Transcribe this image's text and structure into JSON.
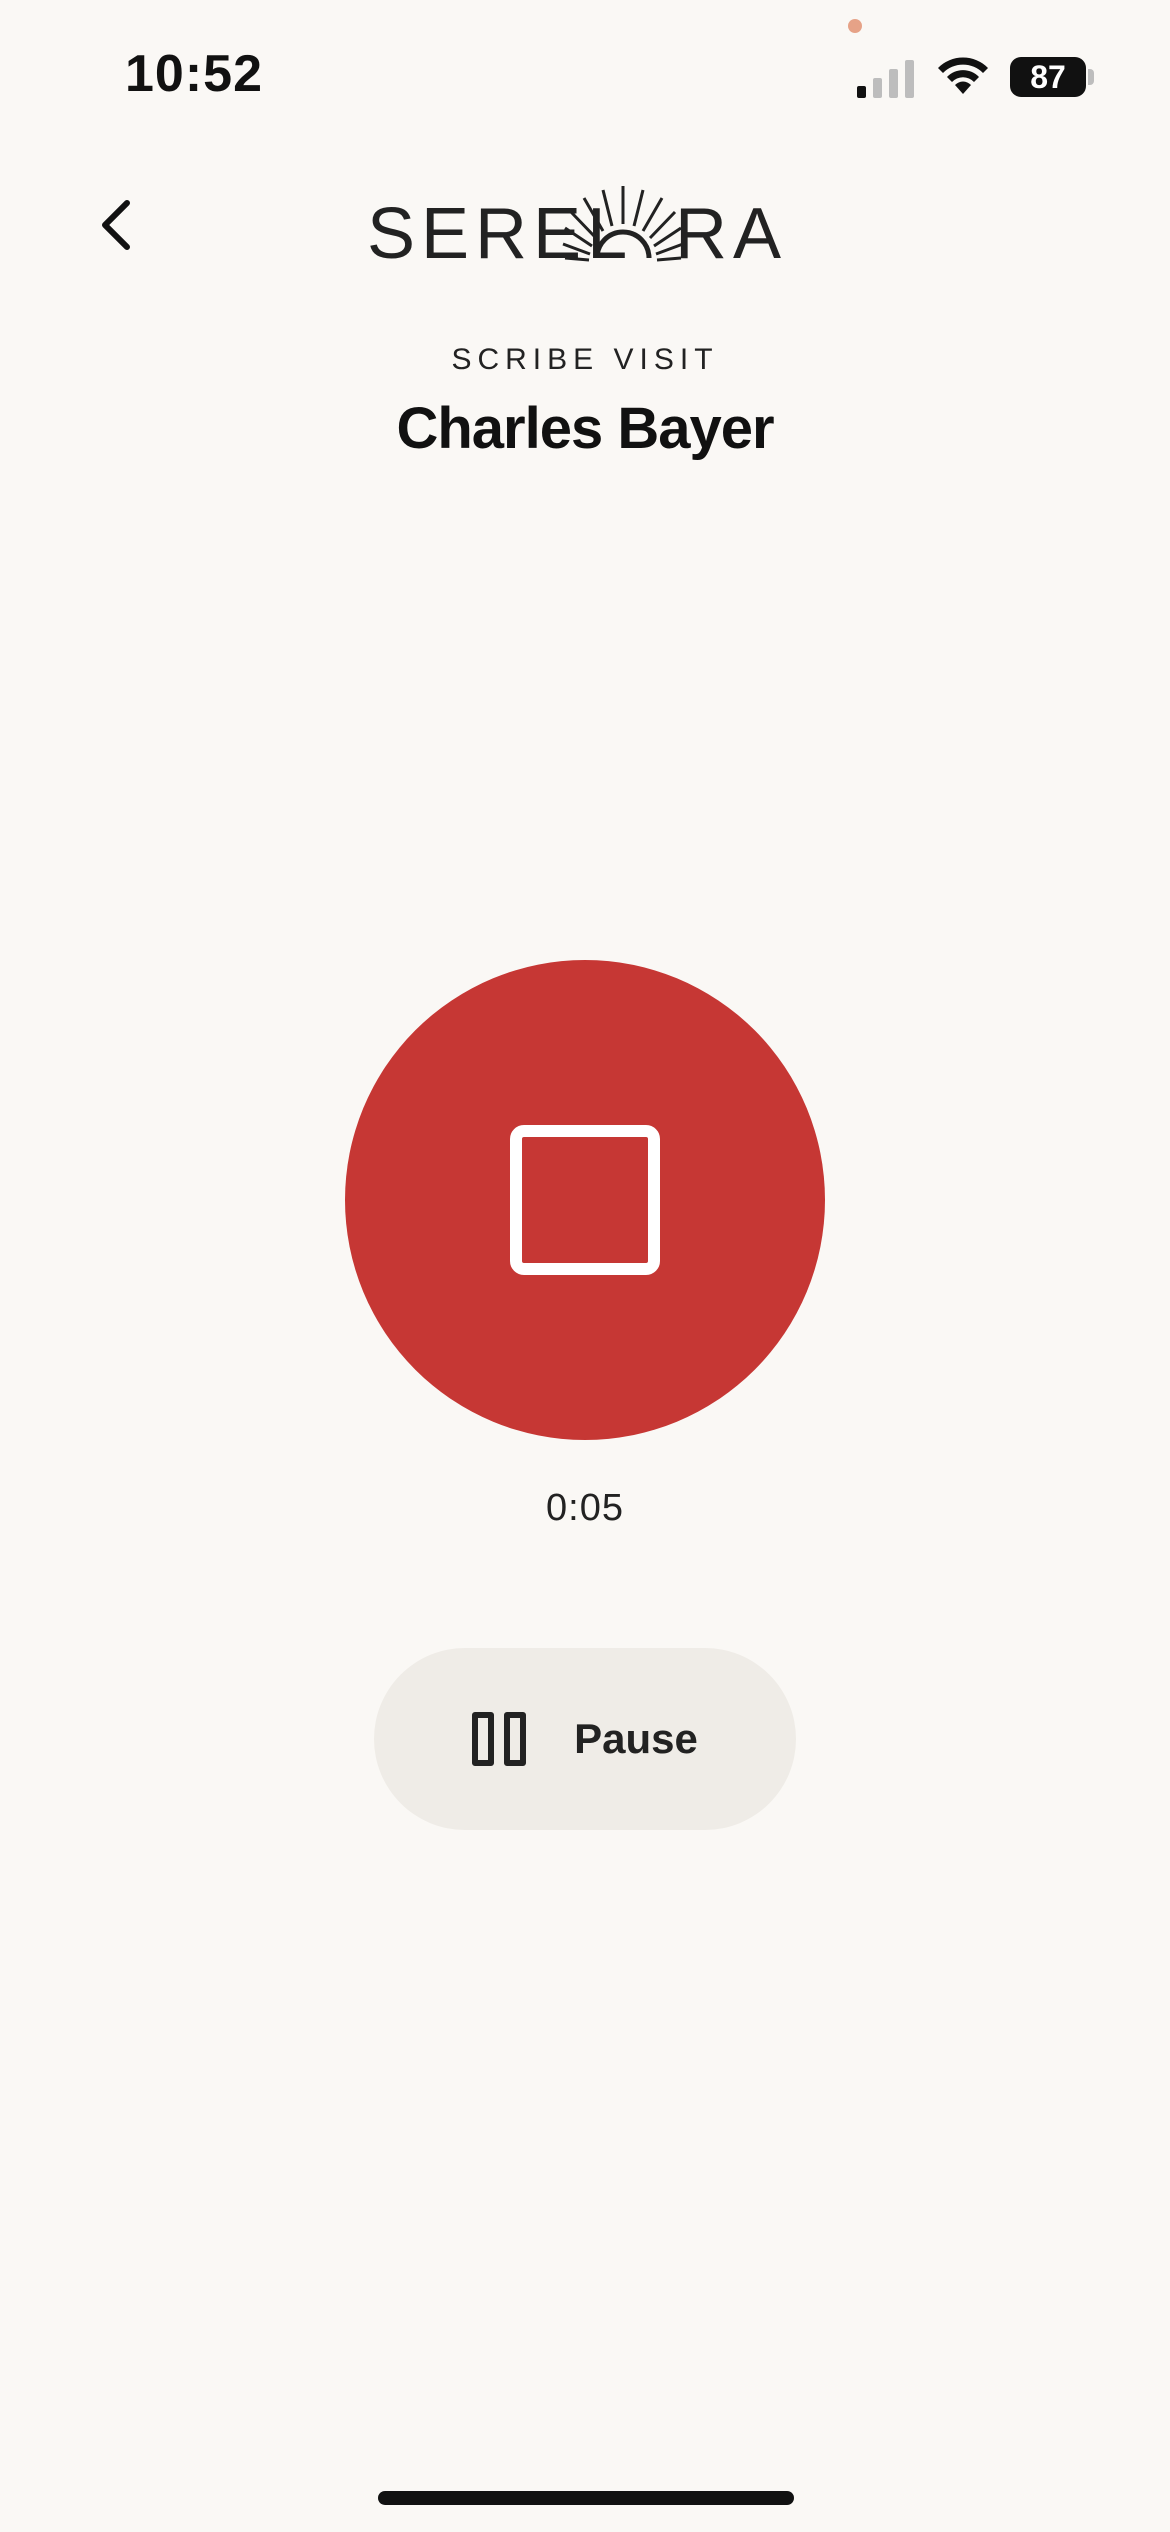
{
  "status_bar": {
    "time": "10:52",
    "battery_level": "87",
    "signal_bars_active": 1,
    "signal_bars_total": 4,
    "recording_dot_color": "#E6A287"
  },
  "header": {
    "back_icon": "chevron-left-icon",
    "logo_text": "SERELORA"
  },
  "visit": {
    "subtitle": "SCRIBE VISIT",
    "patient_name": "Charles Bayer"
  },
  "recorder": {
    "stop_icon": "stop-square-icon",
    "elapsed": "0:05",
    "pause_label": "Pause",
    "pause_icon": "pause-icon"
  },
  "colors": {
    "background": "#FAF8F5",
    "record_red": "#C63734",
    "pill_bg": "#EFECE7",
    "text": "#111111"
  }
}
